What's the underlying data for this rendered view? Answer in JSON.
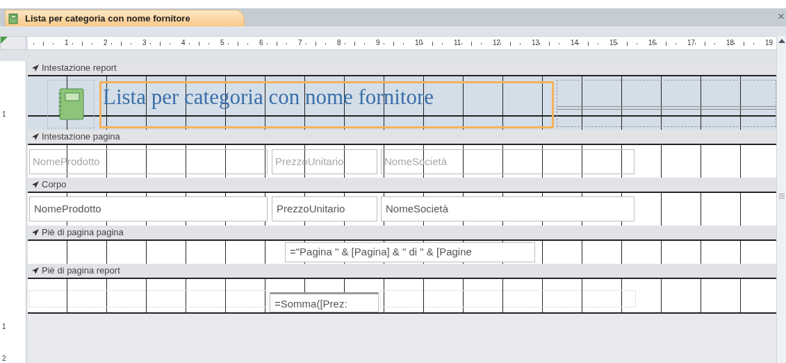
{
  "tab": {
    "title": "Lista per categoria con nome fornitore",
    "close": "×"
  },
  "ruler": {
    "labels": [
      "1",
      "2",
      "3",
      "4",
      "5",
      "6",
      "7",
      "8",
      "9",
      "10",
      "11",
      "12",
      "13",
      "14",
      "15",
      "16",
      "17",
      "18",
      "19"
    ]
  },
  "vertical_ruler": {
    "labels": [
      "1",
      "1",
      "2"
    ]
  },
  "sections": [
    {
      "kind": "report_header",
      "title": "Intestazione report",
      "controls": [
        {
          "kind": "logo",
          "selected": false
        },
        {
          "kind": "title",
          "text": "Lista per categoria con nome fornitore",
          "selected": true
        }
      ]
    },
    {
      "kind": "page_header",
      "title": "Intestazione pagina",
      "controls": [
        {
          "kind": "label",
          "text": "NomeProdotto",
          "selected": false
        },
        {
          "kind": "label",
          "text": "PrezzoUnitario",
          "selected": false
        },
        {
          "kind": "label",
          "text": "NomeSocietà",
          "selected": false
        }
      ]
    },
    {
      "kind": "detail",
      "title": "Corpo",
      "controls": [
        {
          "kind": "textbox",
          "text": "NomeProdotto",
          "selected": false
        },
        {
          "kind": "textbox",
          "text": "PrezzoUnitario",
          "selected": false
        },
        {
          "kind": "textbox",
          "text": "NomeSocietà",
          "selected": false
        }
      ]
    },
    {
      "kind": "page_footer",
      "title": "Piè di pagina pagina",
      "controls": [
        {
          "kind": "textbox",
          "text": "=\"Pagina \" & [Pagina] & \" di \" & [Pagine",
          "selected": false
        }
      ]
    },
    {
      "kind": "report_footer",
      "title": "Piè di pagina report",
      "controls": [
        {
          "kind": "textbox",
          "text": "=Somma([Prez:",
          "selected": false
        }
      ]
    }
  ]
}
